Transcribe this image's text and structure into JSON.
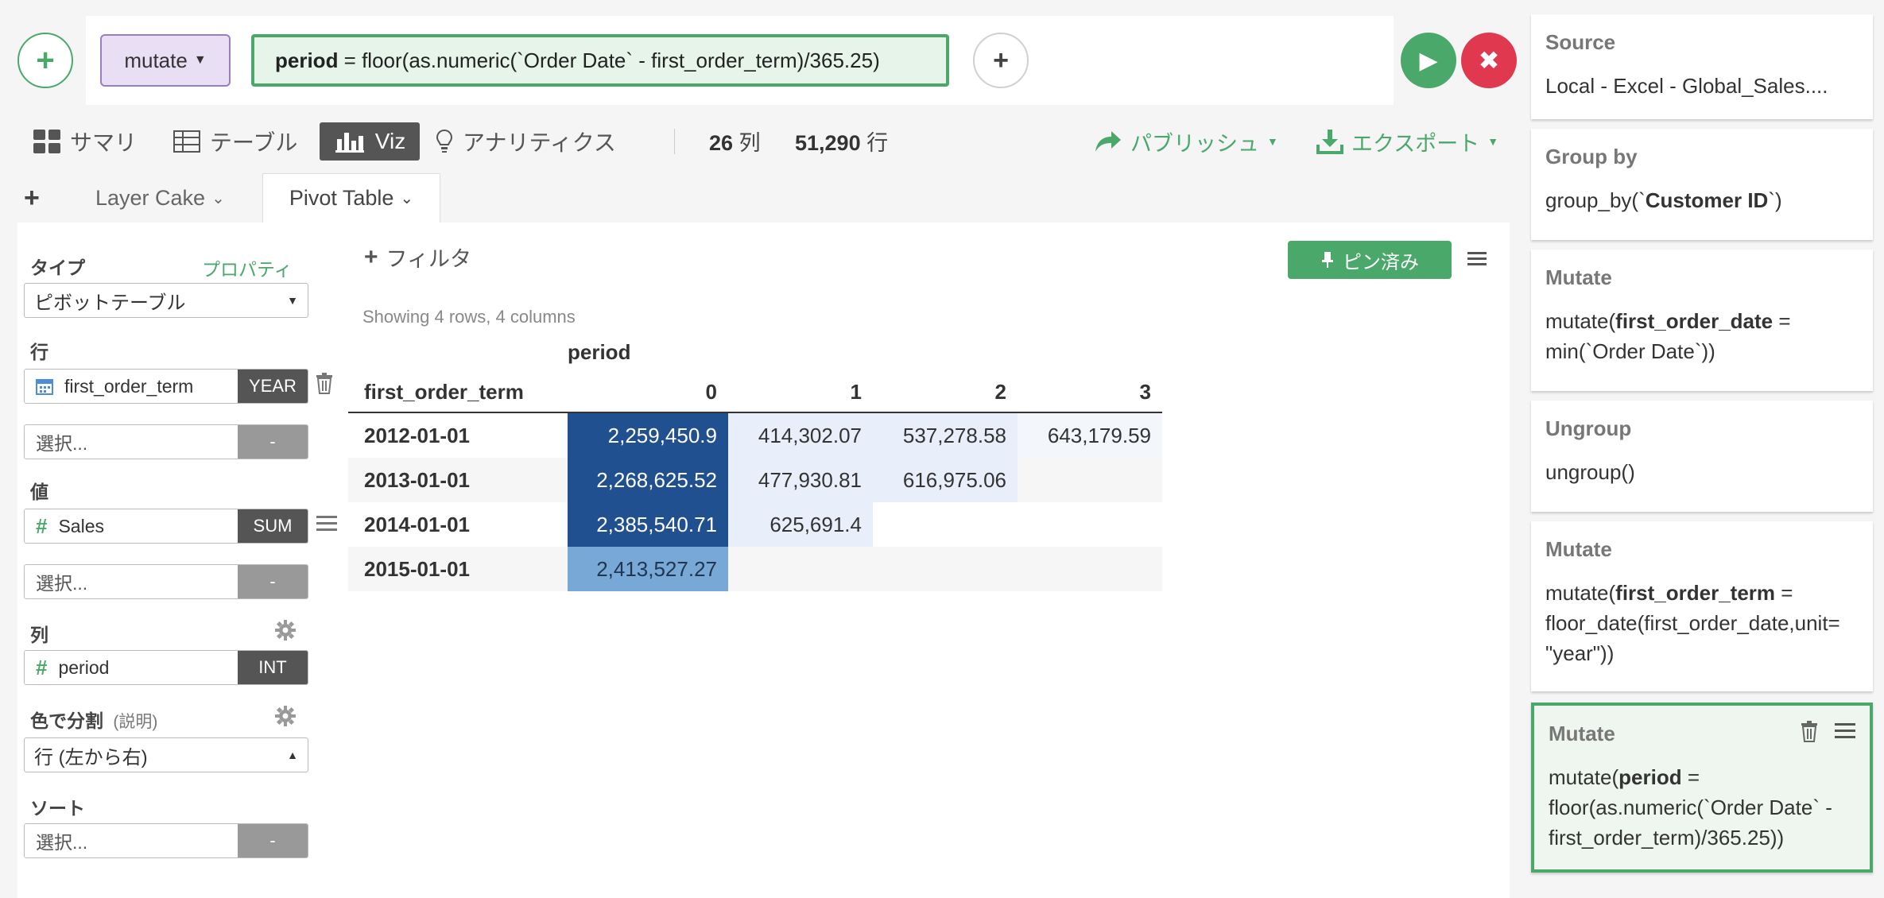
{
  "toolbar": {
    "command": "mutate",
    "formula_bold": "period",
    "formula_rest": " = floor(as.numeric(`Order Date` - first_order_term)/365.25)"
  },
  "view_tabs": {
    "summary": "サマリ",
    "table": "テーブル",
    "viz": "Viz",
    "analytics": "アナリティクス"
  },
  "counts": {
    "columns_num": "26",
    "columns_label": "列",
    "rows_num": "51,290",
    "rows_label": "行"
  },
  "actions": {
    "publish": "パブリッシュ",
    "export": "エクスポート"
  },
  "chart_tabs": {
    "tab1": "Layer Cake",
    "tab2": "Pivot Table"
  },
  "config": {
    "type_label": "タイプ",
    "properties_link": "プロパティ",
    "type_value": "ピボットテーブル",
    "rows_label": "行",
    "row_field": "first_order_term",
    "row_field_tag": "YEAR",
    "select_placeholder": "選択...",
    "empty_tag": "-",
    "values_label": "値",
    "value_field": "Sales",
    "value_field_tag": "SUM",
    "columns_label": "列",
    "column_field": "period",
    "column_field_tag": "INT",
    "color_label": "色で分割",
    "color_hint": "(説明)",
    "color_value": "行 (左から右)",
    "sort_label": "ソート"
  },
  "pivot": {
    "filter_label": "フィルタ",
    "pin_label": "ピン済み",
    "showing": "Showing 4 rows, 4 columns",
    "column_group": "period",
    "row_header": "first_order_term",
    "columns": [
      "0",
      "1",
      "2",
      "3"
    ],
    "rows": [
      {
        "label": "2012-01-01",
        "values": [
          "2,259,450.9",
          "414,302.07",
          "537,278.58",
          "643,179.59"
        ]
      },
      {
        "label": "2013-01-01",
        "values": [
          "2,268,625.52",
          "477,930.81",
          "616,975.06",
          ""
        ]
      },
      {
        "label": "2014-01-01",
        "values": [
          "2,385,540.71",
          "625,691.4",
          "",
          ""
        ]
      },
      {
        "label": "2015-01-01",
        "values": [
          "2,413,527.27",
          "",
          "",
          ""
        ]
      }
    ],
    "colors": {
      "strong": "#20508f",
      "medium": "#78a9d6",
      "light": "#e9effa",
      "lighter": "#f3f6fb",
      "row_alt": "#f6f6f6"
    }
  },
  "steps": {
    "source_title": "Source",
    "source_body": "Local - Excel - Global_Sales....",
    "groupby_title": "Group by",
    "groupby_pre": "group_by(`",
    "groupby_bold": "Customer ID",
    "groupby_post": "`)",
    "mutate1_title": "Mutate",
    "mutate1_pre": "mutate(",
    "mutate1_bold": "first_order_date",
    "mutate1_post": " = min(`Order Date`))",
    "ungroup_title": "Ungroup",
    "ungroup_body": "ungroup()",
    "mutate2_title": "Mutate",
    "mutate2_pre": "mutate(",
    "mutate2_bold": "first_order_term",
    "mutate2_post": " = floor_date(first_order_date,unit= \"year\"))",
    "mutate3_title": "Mutate",
    "mutate3_pre": "mutate(",
    "mutate3_bold": "period",
    "mutate3_post": " = floor(as.numeric(`Order Date` - first_order_term)/365.25))"
  }
}
